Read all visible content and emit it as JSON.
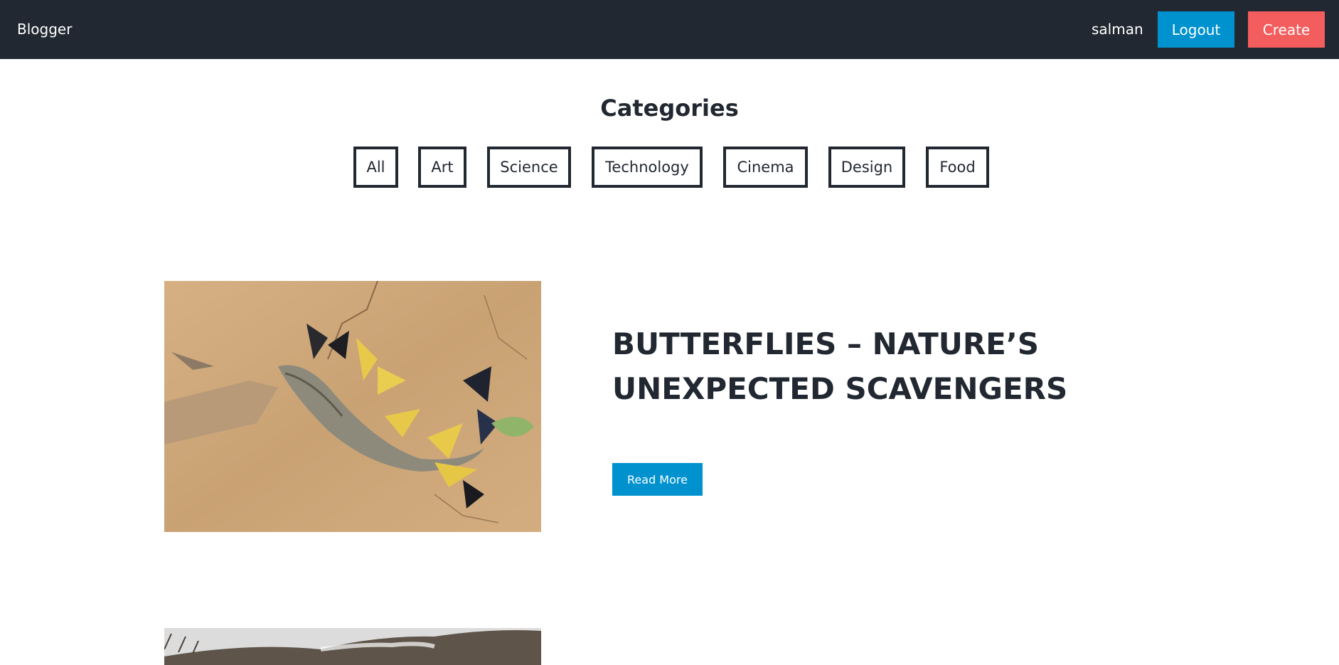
{
  "navbar": {
    "brand": "Blogger",
    "username": "salman",
    "logout_label": "Logout",
    "create_label": "Create",
    "colors": {
      "background": "#222831",
      "logout": "#0092cf",
      "create": "#f45d5d"
    }
  },
  "categories": {
    "title": "Categories",
    "items": [
      {
        "label": "All"
      },
      {
        "label": "Art"
      },
      {
        "label": "Science"
      },
      {
        "label": "Technology"
      },
      {
        "label": "Cinema"
      },
      {
        "label": "Design"
      },
      {
        "label": "Food"
      }
    ]
  },
  "posts": [
    {
      "title": "BUTTERFLIES – NATURE’S UNEXPECTED SCAVENGERS",
      "read_more_label": "Read More",
      "image_icon": "butterflies-on-fish-photo"
    },
    {
      "image_icon": "landscape-hillside-photo"
    }
  ]
}
